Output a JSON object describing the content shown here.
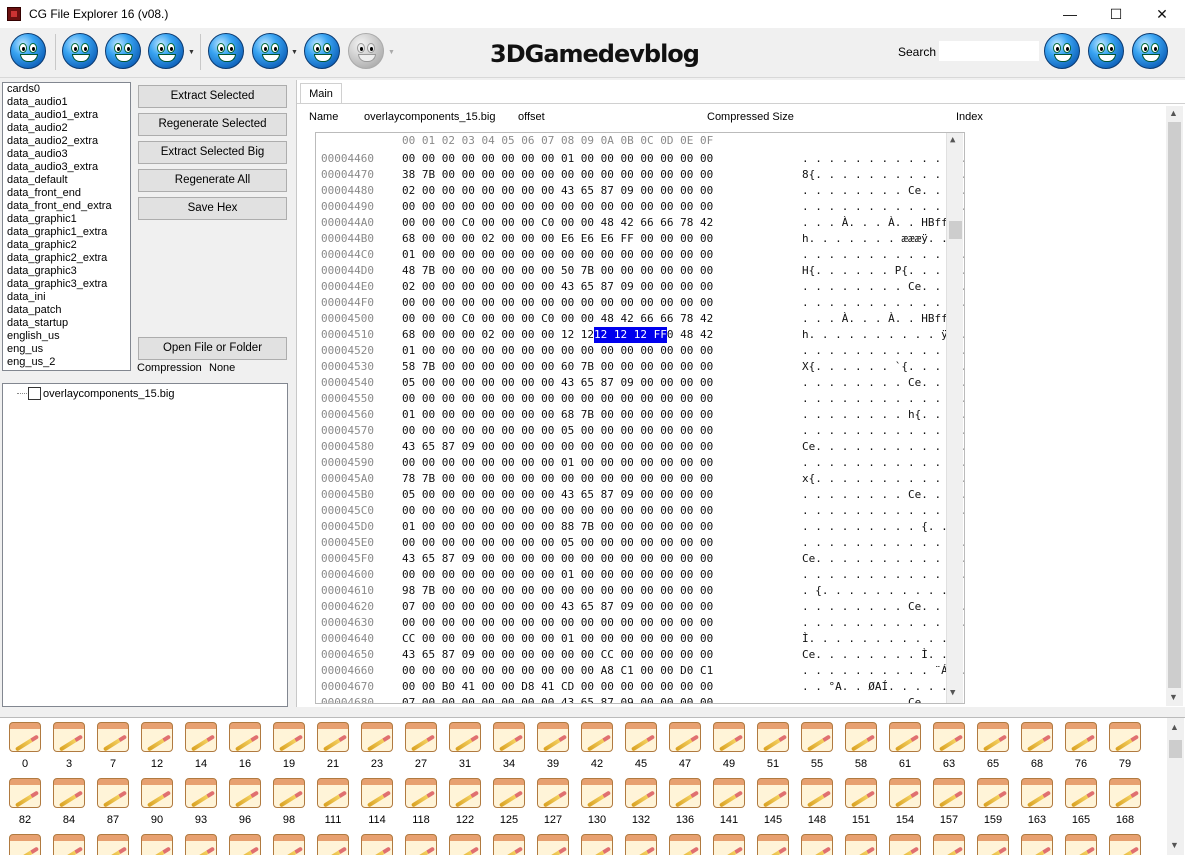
{
  "window": {
    "title": "CG File Explorer 16 (v08.)",
    "minimize": "—",
    "maximize": "☐",
    "close": "✕"
  },
  "toolbar": {
    "logo_text": "3DGamedevblog",
    "search_label": "Search",
    "search_value": "",
    "buttons": [
      "smiley-1",
      "smiley-2",
      "smiley-3",
      "smiley-4",
      "smiley-5",
      "smiley-6",
      "smiley-7",
      "smiley-8",
      "smiley-9",
      "smiley-10",
      "smiley-11"
    ]
  },
  "file_list": [
    "cards0",
    "data_audio1",
    "data_audio1_extra",
    "data_audio2",
    "data_audio2_extra",
    "data_audio3",
    "data_audio3_extra",
    "data_default",
    "data_front_end",
    "data_front_end_extra",
    "data_graphic1",
    "data_graphic1_extra",
    "data_graphic2",
    "data_graphic2_extra",
    "data_graphic3",
    "data_graphic3_extra",
    "data_ini",
    "data_patch",
    "data_startup",
    "english_us",
    "eng_us",
    "eng_us_2"
  ],
  "actions": {
    "extract_selected": "Extract Selected",
    "regenerate_selected": "Regenerate Selected",
    "extract_selected_big": "Extract Selected Big",
    "regenerate_all": "Regenerate All",
    "save_hex": "Save Hex",
    "open_file": "Open File or Folder"
  },
  "compression": {
    "label": "Compression",
    "value": "None"
  },
  "tree": {
    "node": "overlaycomponents_15.big"
  },
  "main": {
    "tab": "Main",
    "columns": {
      "name": "Name",
      "file": "overlaycomponents_15.big",
      "offset": "offset",
      "compressed_size": "Compressed Size",
      "index": "Index"
    }
  },
  "hex": {
    "header": "00 01 02 03 04 05 06 07 08 09 0A 0B 0C 0D 0E 0F",
    "rows": [
      {
        "addr": "00004460",
        "bytes": "00 00 00 00 00 00 00 00 01 00 00 00 00 00 00 00",
        "ascii": ". . . . . . . . . . . . . . . ."
      },
      {
        "addr": "00004470",
        "bytes": "38 7B 00 00 00 00 00 00 00 00 00 00 00 00 00 00",
        "ascii": "8{. . . . . . . . . . . . . ."
      },
      {
        "addr": "00004480",
        "bytes": "02 00 00 00 00 00 00 00 43 65 87 09 00 00 00 00",
        "ascii": ". . . . . . . . Ce. . . . . ."
      },
      {
        "addr": "00004490",
        "bytes": "00 00 00 00 00 00 00 00 00 00 00 00 00 00 00 00",
        "ascii": ". . . . . . . . . . . . . . . ."
      },
      {
        "addr": "000044A0",
        "bytes": "00 00 00 C0 00 00 00 C0 00 00 48 42 66 66 78 42",
        "ascii": ". . . À. . . À. . HBffxB"
      },
      {
        "addr": "000044B0",
        "bytes": "68 00 00 00 02 00 00 00 E6 E6 E6 FF 00 00 00 00",
        "ascii": "h. . . . . . . æææÿ. . . ."
      },
      {
        "addr": "000044C0",
        "bytes": "01 00 00 00 00 00 00 00 00 00 00 00 00 00 00 00",
        "ascii": ". . . . . . . . . . . . . . . ."
      },
      {
        "addr": "000044D0",
        "bytes": "48 7B 00 00 00 00 00 00 50 7B 00 00 00 00 00 00",
        "ascii": "H{. . . . . . P{. . . . . ."
      },
      {
        "addr": "000044E0",
        "bytes": "02 00 00 00 00 00 00 00 43 65 87 09 00 00 00 00",
        "ascii": ". . . . . . . . Ce. . . . . ."
      },
      {
        "addr": "000044F0",
        "bytes": "00 00 00 00 00 00 00 00 00 00 00 00 00 00 00 00",
        "ascii": ". . . . . . . . . . . . . . . ."
      },
      {
        "addr": "00004500",
        "bytes": "00 00 00 C0 00 00 00 C0 00 00 48 42 66 66 78 42",
        "ascii": ". . . À. . . À. . HBffxB"
      },
      {
        "addr": "00004510",
        "bytes": "68 00 00 00 02 00 00 00 12 12 12 FF 00 00 48 42",
        "ascii": "h. . . . . . . . . . ÿ. . HB"
      },
      {
        "addr": "00004520",
        "bytes": "01 00 00 00 00 00 00 00 00 00 00 00 00 00 00 00",
        "ascii": ". . . . . . . . . . . . . . . ."
      },
      {
        "addr": "00004530",
        "bytes": "58 7B 00 00 00 00 00 00 60 7B 00 00 00 00 00 00",
        "ascii": "X{. . . . . . `{. . . . . ."
      },
      {
        "addr": "00004540",
        "bytes": "05 00 00 00 00 00 00 00 43 65 87 09 00 00 00 00",
        "ascii": ". . . . . . . . Ce. . . . . ."
      },
      {
        "addr": "00004550",
        "bytes": "00 00 00 00 00 00 00 00 00 00 00 00 00 00 00 00",
        "ascii": ". . . . . . . . . . . . . . . ."
      },
      {
        "addr": "00004560",
        "bytes": "01 00 00 00 00 00 00 00 68 7B 00 00 00 00 00 00",
        "ascii": ". . . . . . . . h{. . . . . ."
      },
      {
        "addr": "00004570",
        "bytes": "00 00 00 00 00 00 00 00 05 00 00 00 00 00 00 00",
        "ascii": ". . . . . . . . . . . . . . . ."
      },
      {
        "addr": "00004580",
        "bytes": "43 65 87 09 00 00 00 00 00 00 00 00 00 00 00 00",
        "ascii": "Ce. . . . . . . . . . . . . ."
      },
      {
        "addr": "00004590",
        "bytes": "00 00 00 00 00 00 00 00 01 00 00 00 00 00 00 00",
        "ascii": ". . . . . . . . . . . . . . . ."
      },
      {
        "addr": "000045A0",
        "bytes": "78 7B 00 00 00 00 00 00 00 00 00 00 00 00 00 00",
        "ascii": "x{. . . . . . . . . . . . . ."
      },
      {
        "addr": "000045B0",
        "bytes": "05 00 00 00 00 00 00 00 43 65 87 09 00 00 00 00",
        "ascii": ". . . . . . . . Ce. . . . . ."
      },
      {
        "addr": "000045C0",
        "bytes": "00 00 00 00 00 00 00 00 00 00 00 00 00 00 00 00",
        "ascii": ". . . . . . . . . . . . . . . ."
      },
      {
        "addr": "000045D0",
        "bytes": "01 00 00 00 00 00 00 00 88 7B 00 00 00 00 00 00",
        "ascii": ". . . . . . . . . {. . . . . ."
      },
      {
        "addr": "000045E0",
        "bytes": "00 00 00 00 00 00 00 00 05 00 00 00 00 00 00 00",
        "ascii": ". . . . . . . . . . . . . . . ."
      },
      {
        "addr": "000045F0",
        "bytes": "43 65 87 09 00 00 00 00 00 00 00 00 00 00 00 00",
        "ascii": "Ce. . . . . . . . . . . . . ."
      },
      {
        "addr": "00004600",
        "bytes": "00 00 00 00 00 00 00 00 01 00 00 00 00 00 00 00",
        "ascii": ". . . . . . . . . . . . . . . ."
      },
      {
        "addr": "00004610",
        "bytes": "98 7B 00 00 00 00 00 00 00 00 00 00 00 00 00 00",
        "ascii": ". {. . . . . . . . . . . . . ."
      },
      {
        "addr": "00004620",
        "bytes": "07 00 00 00 00 00 00 00 43 65 87 09 00 00 00 00",
        "ascii": ". . . . . . . . Ce. . . . . ."
      },
      {
        "addr": "00004630",
        "bytes": "00 00 00 00 00 00 00 00 00 00 00 00 00 00 00 00",
        "ascii": ". . . . . . . . . . . . . . . ."
      },
      {
        "addr": "00004640",
        "bytes": "CC 00 00 00 00 00 00 00 01 00 00 00 00 00 00 00",
        "ascii": "Ì. . . . . . . . . . . . . . ."
      },
      {
        "addr": "00004650",
        "bytes": "43 65 87 09 00 00 00 00 00 00 CC 00 00 00 00 00",
        "ascii": "Ce. . . . . . . . Ì. . . . ."
      },
      {
        "addr": "00004660",
        "bytes": "00 00 00 00 00 00 00 00 00 00 A8 C1 00 00 D0 C1",
        "ascii": ". . . . . . . . . . ¨Á. . ÐÁ"
      },
      {
        "addr": "00004670",
        "bytes": "00 00 B0 41 00 00 D8 41 CD 00 00 00 00 00 00 00",
        "ascii": ". . °A. . ØAÍ. . . . . . ."
      },
      {
        "addr": "00004680",
        "bytes": "07 00 00 00 00 00 00 00 43 65 87 09 00 00 00 00",
        "ascii": ". . . . . . . . Ce. . . . . ."
      }
    ],
    "selected": "12 12 12 FF"
  },
  "icons": {
    "row1": [
      "0",
      "3",
      "7",
      "12",
      "14",
      "16",
      "19",
      "21",
      "23",
      "27",
      "31",
      "34",
      "39",
      "42",
      "45",
      "47",
      "49",
      "51",
      "55",
      "58",
      "61",
      "63",
      "65",
      "68",
      "76",
      "79"
    ],
    "row2": [
      "82",
      "84",
      "87",
      "90",
      "93",
      "96",
      "98",
      "111",
      "114",
      "118",
      "122",
      "125",
      "127",
      "130",
      "132",
      "136",
      "141",
      "145",
      "148",
      "151",
      "154",
      "157",
      "159",
      "163",
      "165",
      "168"
    ]
  }
}
